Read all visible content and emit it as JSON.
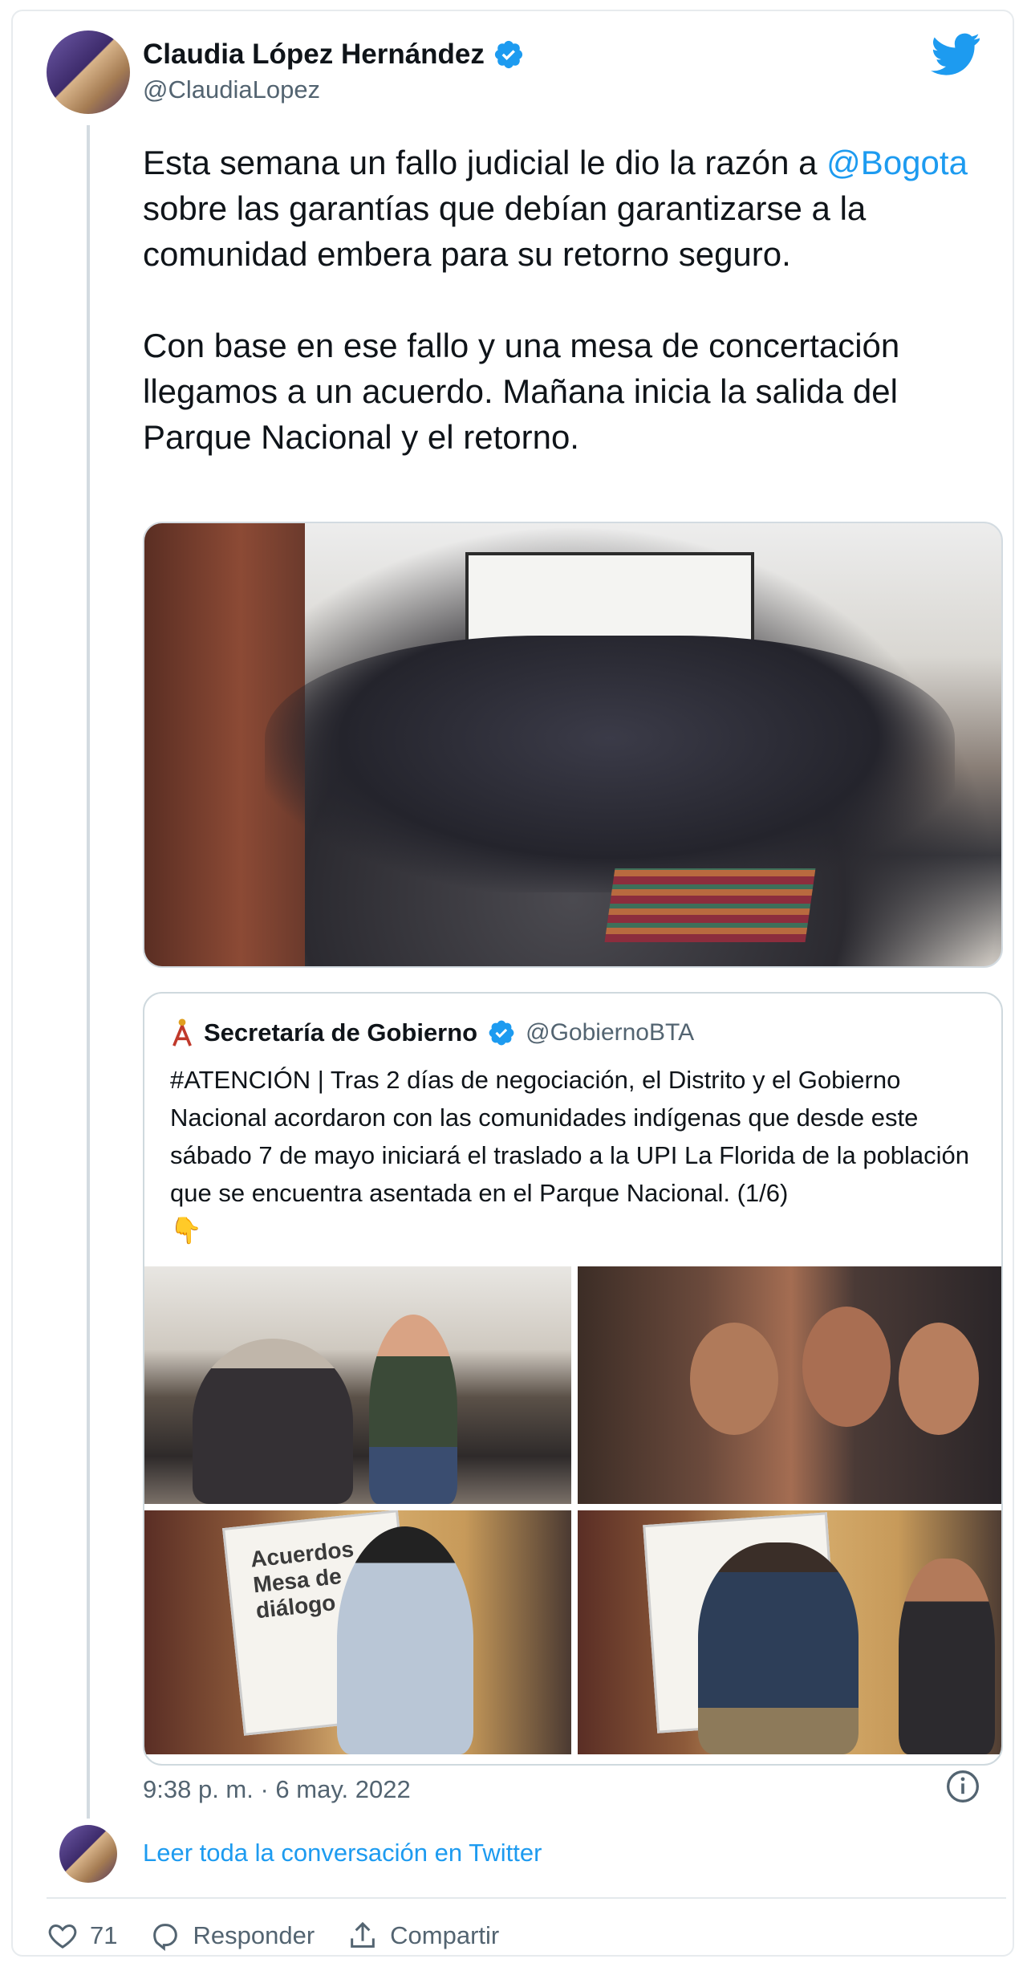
{
  "author": {
    "name": "Claudia López Hernández",
    "handle": "@ClaudiaLopez"
  },
  "tweet": {
    "paragraph1_pre": "Esta semana un fallo judicial le dio la razón a ",
    "paragraph1_mention": "@Bogota",
    "paragraph1_post": " sobre las garantías que debían garantizarse a la comunidad embera para su retorno seguro.",
    "paragraph2": "Con base en ese fallo y una mesa de concertación llegamos a un acuerdo. Mañana inicia la salida del Parque Nacional y el retorno."
  },
  "quoted": {
    "name": "Secretaría de Gobierno",
    "handle": "@GobiernoBTA",
    "text": "#ATENCIÓN | Tras 2 días de negociación, el Distrito y el Gobierno Nacional acordaron con las comunidades indígenas que desde este sábado 7 de mayo iniciará el traslado a la UPI La Florida de la población que se encuentra asentada en el Parque Nacional. (1/6)",
    "emoji": "👇",
    "board_text": "Acuerdos Mesa de diálogo"
  },
  "meta": {
    "timestamp": "9:38 p. m. · 6 may. 2022",
    "read_conversation": "Leer toda la conversación en Twitter"
  },
  "actions": {
    "likes": "71",
    "reply": "Responder",
    "share": "Compartir"
  },
  "colors": {
    "accent": "#1d9bf0",
    "text": "#0f1419",
    "muted": "#536471"
  },
  "icons": [
    "verified-icon",
    "twitter-bird-icon",
    "info-icon",
    "heart-icon",
    "reply-icon",
    "share-icon"
  ]
}
